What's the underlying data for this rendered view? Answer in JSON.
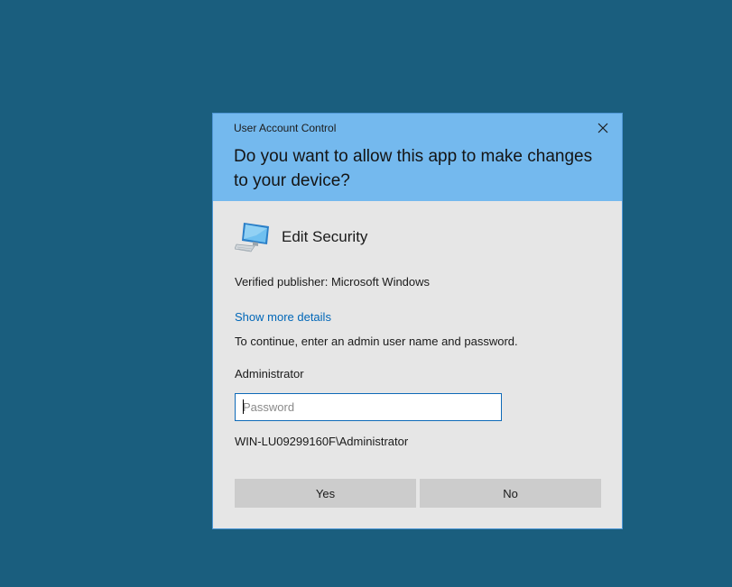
{
  "colors": {
    "desktop": "#1a5e7e",
    "header": "#74b9ee",
    "dialog_body": "#e6e6e6",
    "link": "#0067b8",
    "button": "#cccccc"
  },
  "dialog": {
    "title": "User Account Control",
    "close_icon": "close-icon",
    "question": "Do you want to allow this app to make changes to your device?",
    "app_icon": "computer-monitor-icon",
    "app_name": "Edit Security",
    "publisher": "Verified publisher: Microsoft Windows",
    "details_link": "Show more details",
    "instruction": "To continue, enter an admin user name and password.",
    "username": "Administrator",
    "password": {
      "value": "",
      "placeholder": "Password"
    },
    "account": "WIN-LU09299160F\\Administrator",
    "buttons": {
      "yes": "Yes",
      "no": "No"
    }
  }
}
